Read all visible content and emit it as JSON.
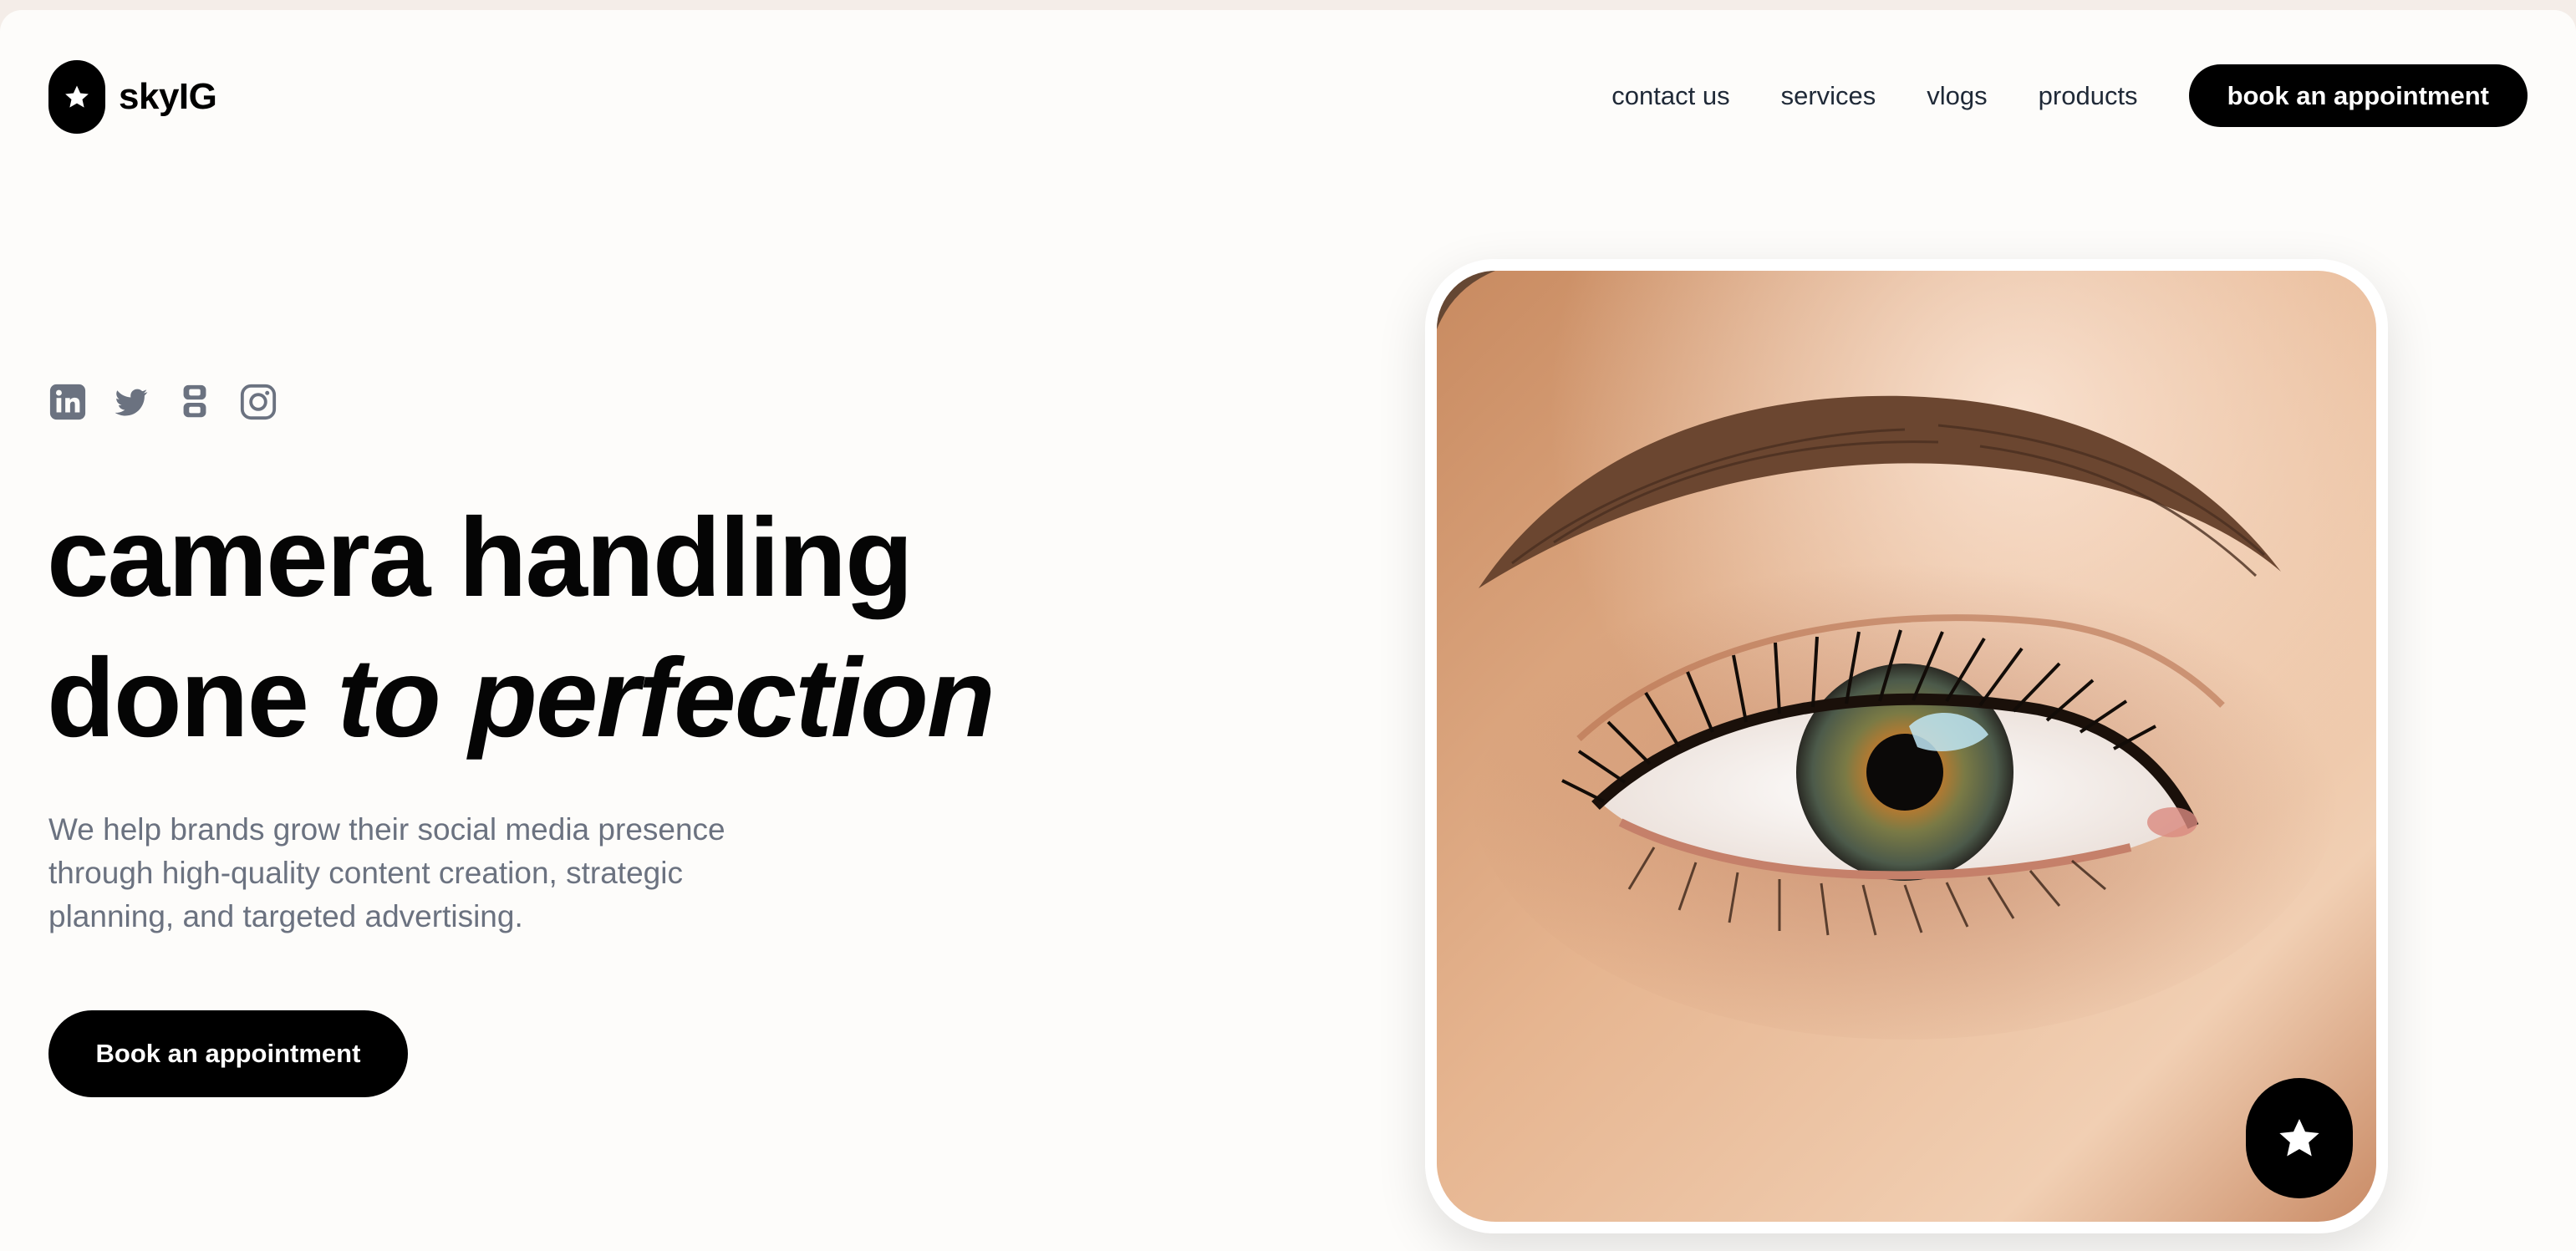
{
  "brand": {
    "name": "skyIG",
    "logo_icon": "star-icon"
  },
  "nav": {
    "links": [
      "contact us",
      "services",
      "vlogs",
      "products"
    ],
    "cta_label": "book an appointment"
  },
  "socials": [
    {
      "name": "linkedin-icon"
    },
    {
      "name": "twitter-icon"
    },
    {
      "name": "threads-icon"
    },
    {
      "name": "instagram-icon"
    }
  ],
  "hero": {
    "headline_line1": "camera handling",
    "headline_line2_plain": "done",
    "headline_line2_italic": "to perfection",
    "subtext": "We help brands grow their social media presence through high-quality content creation, strategic planning, and targeted advertising.",
    "cta_label": "Book an appointment",
    "image_badge_icon": "star-icon"
  },
  "colors": {
    "page_bg": "#fdfcfa",
    "outer_bg": "#f4ede8",
    "primary": "#000000",
    "muted_text": "#6b7280",
    "social_icon": "#6b7280"
  }
}
